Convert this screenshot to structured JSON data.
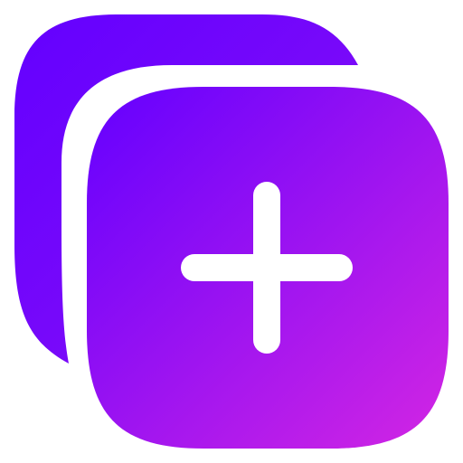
{
  "icon": {
    "name": "duplicate-add-icon",
    "colors": {
      "gradient_start": "#6300FF",
      "gradient_end": "#D326E3",
      "plus": "#FFFFFF",
      "background": "#FFFFFF"
    }
  }
}
